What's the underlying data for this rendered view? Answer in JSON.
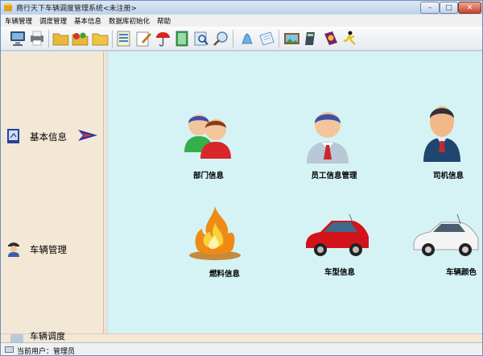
{
  "window": {
    "title": "商行天下车辆调度管理系统<未注册>",
    "controls": {
      "minimize": "–",
      "maximize": "□",
      "close": "✕"
    }
  },
  "menu": [
    "车辆管理",
    "调度管理",
    "基本信息",
    "数据库初始化",
    "帮助"
  ],
  "toolbar": {
    "icons": [
      "monitor-icon",
      "printer-icon",
      "folder-icon",
      "folder-arrow-icon",
      "folder-open-icon",
      "report-icon",
      "edit-document-icon",
      "umbrella-icon",
      "book-icon",
      "zoom-icon",
      "search-icon",
      "bell-icon",
      "note-icon",
      "picture-icon",
      "calculator-icon",
      "help-book-icon",
      "running-man-icon"
    ]
  },
  "nav": {
    "items": [
      {
        "label": "基本信息",
        "icon": "info-book-icon",
        "active": true
      },
      {
        "label": "车辆管理",
        "icon": "driver-icon",
        "active": false
      },
      {
        "label": "车辆调度",
        "icon": "dispatch-icon",
        "active": false
      }
    ]
  },
  "tiles": [
    {
      "label": "部门信息",
      "icon": "department-people-icon"
    },
    {
      "label": "员工信息管理",
      "icon": "employee-person-icon"
    },
    {
      "label": "司机信息",
      "icon": "driver-person-icon"
    },
    {
      "label": "燃料信息",
      "icon": "fire-icon"
    },
    {
      "label": "车型信息",
      "icon": "red-car-icon"
    },
    {
      "label": "车辆颜色",
      "icon": "white-car-icon"
    }
  ],
  "status": {
    "text": "当前用户：管理员"
  },
  "colors": {
    "content_bg": "#d5f3f5",
    "nav_bg": "#f3e7d6",
    "accent_arrow": "#2b2f9c"
  }
}
